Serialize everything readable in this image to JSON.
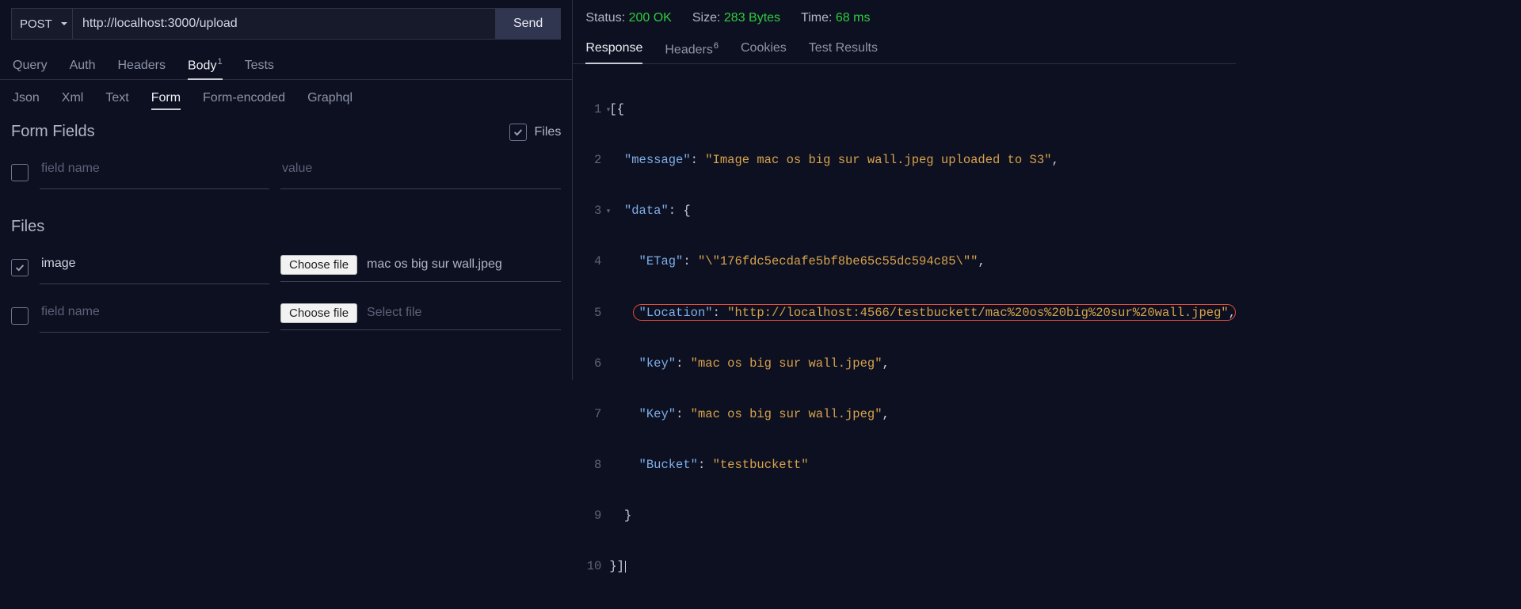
{
  "request": {
    "method": "POST",
    "url": "http://localhost:3000/upload",
    "send_label": "Send",
    "tabs": {
      "query": "Query",
      "auth": "Auth",
      "headers": "Headers",
      "body": "Body",
      "body_count": "1",
      "tests": "Tests"
    },
    "body_types": {
      "json": "Json",
      "xml": "Xml",
      "text": "Text",
      "form": "Form",
      "form_encoded": "Form-encoded",
      "graphql": "Graphql"
    },
    "form": {
      "section_label": "Form Fields",
      "files_toggle_label": "Files",
      "field_name_placeholder": "field name",
      "value_placeholder": "value",
      "files_section_label": "Files",
      "choose_file_label": "Choose file",
      "select_file_placeholder": "Select file",
      "rows": {
        "image_name": "image",
        "image_file": "mac os big sur wall.jpeg"
      }
    }
  },
  "response": {
    "status_label": "Status:",
    "status_value": "200 OK",
    "size_label": "Size:",
    "size_value": "283 Bytes",
    "time_label": "Time:",
    "time_value": "68 ms",
    "tabs": {
      "response": "Response",
      "headers": "Headers",
      "headers_count": "6",
      "cookies": "Cookies",
      "test_results": "Test Results"
    },
    "body": {
      "message_key": "\"message\"",
      "message_val": "\"Image mac os big sur wall.jpeg uploaded to S3\"",
      "data_key": "\"data\"",
      "etag_key": "\"ETag\"",
      "etag_val": "\"\\\"176fdc5ecdafe5bf8be65c55dc594c85\\\"\"",
      "location_key": "\"Location\"",
      "location_val": "\"http://localhost:4566/testbuckett/mac%20os%20big%20sur%20wall.jpeg\"",
      "key_key": "\"key\"",
      "key_val": "\"mac os big sur wall.jpeg\"",
      "Key_key": "\"Key\"",
      "Key_val": "\"mac os big sur wall.jpeg\"",
      "bucket_key": "\"Bucket\"",
      "bucket_val": "\"testbuckett\""
    }
  }
}
